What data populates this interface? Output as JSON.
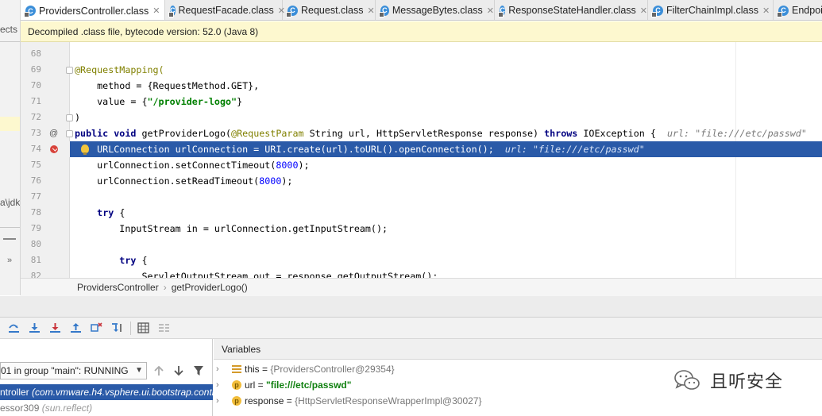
{
  "left_strip": {
    "fragment_top": "ects",
    "fragment_mid": "a\\jdk",
    "chevron": "»"
  },
  "tabs": [
    {
      "label": "ProvidersController.class",
      "active": true
    },
    {
      "label": "RequestFacade.class",
      "active": false
    },
    {
      "label": "Request.class",
      "active": false
    },
    {
      "label": "MessageBytes.class",
      "active": false
    },
    {
      "label": "ResponseStateHandler.class",
      "active": false
    },
    {
      "label": "FilterChainImpl.class",
      "active": false
    },
    {
      "label": "Endpoi",
      "active": false
    }
  ],
  "banner": {
    "text": "Decompiled .class file, bytecode version: 52.0 (Java 8)"
  },
  "code": [
    {
      "line": "68"
    },
    {
      "line": "69",
      "tokens": [
        {
          "t": "@RequestMapping(",
          "c": "ann"
        }
      ]
    },
    {
      "line": "70",
      "tokens": [
        {
          "t": "    method = {RequestMethod.GET},",
          "c": ""
        }
      ]
    },
    {
      "line": "71",
      "tokens": [
        {
          "t": "    value = {",
          "c": ""
        },
        {
          "t": "\"/provider-logo\"",
          "c": "str"
        },
        {
          "t": "}",
          "c": ""
        }
      ]
    },
    {
      "line": "72",
      "tokens": [
        {
          "t": ")",
          "c": ""
        }
      ]
    },
    {
      "line": "73",
      "tokens": [
        {
          "t": "public void ",
          "c": "kw"
        },
        {
          "t": "getProviderLogo(",
          "c": ""
        },
        {
          "t": "@RequestParam",
          "c": "ann"
        },
        {
          "t": " String url, HttpServletResponse response) ",
          "c": ""
        },
        {
          "t": "throws ",
          "c": "kw"
        },
        {
          "t": "IOException {  ",
          "c": ""
        },
        {
          "t": "url: \"file:///etc/passwd\"",
          "c": "inl"
        }
      ]
    },
    {
      "line": "74",
      "tokens": [
        {
          "t": "    URLConnection urlConnection = URI.create(url).toURL().openConnection();  ",
          "c": ""
        },
        {
          "t": "url: \"file:///etc/passwd\"",
          "c": "inl"
        }
      ]
    },
    {
      "line": "75",
      "tokens": [
        {
          "t": "    urlConnection.setConnectTimeout(",
          "c": ""
        },
        {
          "t": "8000",
          "c": "num"
        },
        {
          "t": ");",
          "c": ""
        }
      ]
    },
    {
      "line": "76",
      "tokens": [
        {
          "t": "    urlConnection.setReadTimeout(",
          "c": ""
        },
        {
          "t": "8000",
          "c": "num"
        },
        {
          "t": ");",
          "c": ""
        }
      ]
    },
    {
      "line": "77"
    },
    {
      "line": "78",
      "tokens": [
        {
          "t": "    ",
          "c": ""
        },
        {
          "t": "try",
          "c": "kw"
        },
        {
          "t": " {",
          "c": ""
        }
      ]
    },
    {
      "line": "79",
      "tokens": [
        {
          "t": "        InputStream in = urlConnection.getInputStream();",
          "c": ""
        }
      ]
    },
    {
      "line": "80"
    },
    {
      "line": "81",
      "tokens": [
        {
          "t": "        ",
          "c": ""
        },
        {
          "t": "try",
          "c": "kw"
        },
        {
          "t": " {",
          "c": ""
        }
      ]
    },
    {
      "line": "82",
      "tokens": [
        {
          "t": "            ServletOutputStream out = response.getOutputStream();",
          "c": ""
        }
      ]
    }
  ],
  "breadcrumb": {
    "class_name": "ProvidersController",
    "method": "getProviderLogo()"
  },
  "debugger": {
    "thread_select": "01 in group \"main\": RUNNING",
    "frames": [
      {
        "name": "ntroller",
        "pkg": "(com.vmware.h4.vsphere.ui.bootstrap.contro",
        "selected": true
      },
      {
        "name": "essor309",
        "pkg": "(sun.reflect)",
        "selected": false
      }
    ],
    "variables_title": "Variables",
    "variables": [
      {
        "name": "this",
        "value": "{ProvidersController@29354}",
        "kind": "obj",
        "icon": "fields-icon"
      },
      {
        "name": "url",
        "value": "\"file:///etc/passwd\"",
        "kind": "str",
        "icon": "p"
      },
      {
        "name": "response",
        "value": "{HttpServletResponseWrapperImpl@30027}",
        "kind": "obj",
        "icon": "p"
      }
    ]
  },
  "watermark": {
    "text": "且听安全"
  }
}
